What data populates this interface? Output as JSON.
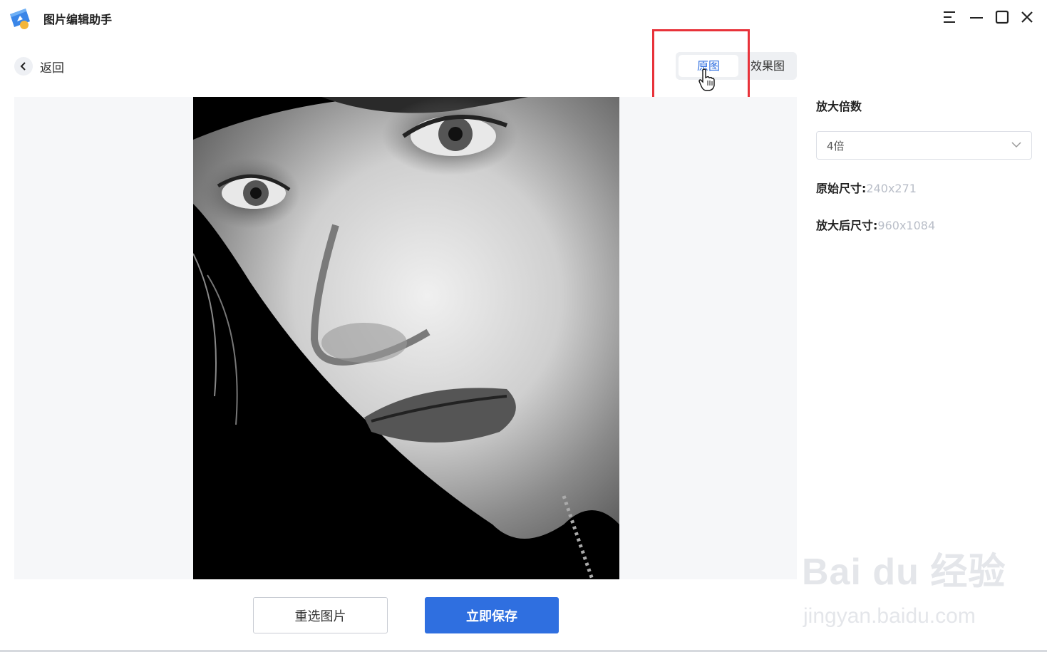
{
  "app": {
    "title": "图片编辑助手"
  },
  "nav": {
    "back_label": "返回"
  },
  "view_toggle": {
    "original": "原图",
    "result": "效果图",
    "active": "original"
  },
  "sidebar": {
    "scale_label": "放大倍数",
    "scale_value": "4倍",
    "original_size_label": "原始尺寸:",
    "original_size_value": "240x271",
    "scaled_size_label": "放大后尺寸:",
    "scaled_size_value": "960x1084"
  },
  "actions": {
    "reselect": "重选图片",
    "save": "立即保存"
  },
  "watermark": {
    "main": "Bai du 经验",
    "sub": "jingyan.baidu.com"
  },
  "colors": {
    "accent": "#2f6fe0",
    "highlight": "#e8323a",
    "preview_bg": "#f6f7f9"
  },
  "icons": [
    "app-logo-icon",
    "menu-icon",
    "minimize-icon",
    "maximize-icon",
    "close-icon",
    "back-chevron-icon",
    "chevron-down-icon",
    "hand-cursor-icon"
  ]
}
